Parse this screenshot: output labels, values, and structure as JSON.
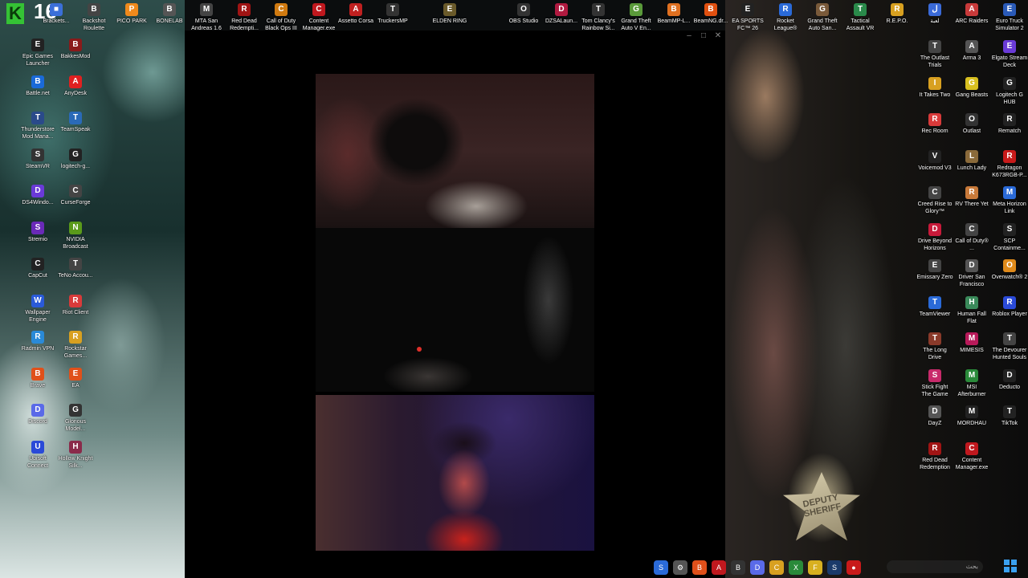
{
  "overlay": {
    "logo_letter": "K",
    "count": "16"
  },
  "window": {
    "controls": [
      "–",
      "□",
      "✕"
    ]
  },
  "badge": {
    "text": "DEPUTY SHERIFF"
  },
  "top_icons": [
    {
      "label": "Brackets...",
      "color": "#3b6fd8",
      "glyph": "■"
    },
    {
      "label": "Backshot Roulette",
      "color": "#444",
      "glyph": "B"
    },
    {
      "label": "PICO PARK",
      "color": "#f08a1c",
      "glyph": "P"
    },
    {
      "label": "BONELAB",
      "color": "#555",
      "glyph": "B"
    },
    {
      "label": "MTA San Andreas 1.6",
      "color": "#444",
      "glyph": "M"
    },
    {
      "label": "Red Dead Redempti...",
      "color": "#a01414",
      "glyph": "R"
    },
    {
      "label": "Call of Duty Black Ops III",
      "color": "#d07a10",
      "glyph": "C"
    },
    {
      "label": "Content Manager.exe",
      "color": "#c0181e",
      "glyph": "C"
    },
    {
      "label": "Assetto Corsa",
      "color": "#c02020",
      "glyph": "A"
    },
    {
      "label": "TruckersMP",
      "color": "#333",
      "glyph": "T"
    },
    {
      "label": "ELDEN RING",
      "color": "#6a5a2a",
      "glyph": "E"
    },
    {
      "label": "OBS Studio",
      "color": "#333",
      "glyph": "O"
    },
    {
      "label": "DZSALaun...",
      "color": "#b01a40",
      "glyph": "D"
    },
    {
      "label": "Tom Clancy's Rainbow Si...",
      "color": "#333",
      "glyph": "T"
    },
    {
      "label": "Grand Theft Auto V En...",
      "color": "#5a9a3a",
      "glyph": "G"
    },
    {
      "label": "BeamMP-L...",
      "color": "#e07020",
      "glyph": "B"
    },
    {
      "label": "BeamNG.dr...",
      "color": "#e05010",
      "glyph": "B"
    },
    {
      "label": "EA SPORTS FC™ 26",
      "color": "#222",
      "glyph": "E"
    },
    {
      "label": "Rocket League®",
      "color": "#2a6ad8",
      "glyph": "R"
    },
    {
      "label": "Grand Theft Auto San...",
      "color": "#7a5a3a",
      "glyph": "G"
    },
    {
      "label": "Tactical Assault VR",
      "color": "#2a8a4a",
      "glyph": "T"
    },
    {
      "label": "R.E.P.O.",
      "color": "#d8a020",
      "glyph": "R"
    },
    {
      "label": "لعبة",
      "color": "#3a6ad8",
      "glyph": "ل"
    },
    {
      "label": "ARC Raiders",
      "color": "#c83a3a",
      "glyph": "A"
    },
    {
      "label": "Euro Truck Simulator 2",
      "color": "#2a5ab8",
      "glyph": "E"
    }
  ],
  "left_icons": [
    {
      "label": "Epic Games Launcher",
      "color": "#222",
      "glyph": "E"
    },
    {
      "label": "BakkesMod",
      "color": "#8a1a1a",
      "glyph": "B"
    },
    {
      "label": "Battle.net",
      "color": "#1a6ad8",
      "glyph": "B"
    },
    {
      "label": "AnyDesk",
      "color": "#e02020",
      "glyph": "A"
    },
    {
      "label": "Thunderstore Mod Mana...",
      "color": "#2a4a8a",
      "glyph": "T"
    },
    {
      "label": "TeamSpeak",
      "color": "#2a6ab8",
      "glyph": "T"
    },
    {
      "label": "SteamVR",
      "color": "#333",
      "glyph": "S"
    },
    {
      "label": "logitech-g...",
      "color": "#222",
      "glyph": "G"
    },
    {
      "label": "DS4Windo...",
      "color": "#6a3ad8",
      "glyph": "D"
    },
    {
      "label": "CurseForge",
      "color": "#444",
      "glyph": "C"
    },
    {
      "label": "Stremio",
      "color": "#6a2ab8",
      "glyph": "S"
    },
    {
      "label": "NVIDIA Broadcast",
      "color": "#5a9a1a",
      "glyph": "N"
    },
    {
      "label": "CapCut",
      "color": "#222",
      "glyph": "C"
    },
    {
      "label": "TeNo Accou...",
      "color": "#444",
      "glyph": "T"
    },
    {
      "label": "Wallpaper Engine",
      "color": "#2a5ad8",
      "glyph": "W"
    },
    {
      "label": "Riot Client",
      "color": "#d83a3a",
      "glyph": "R"
    },
    {
      "label": "Radmin VPN",
      "color": "#2a8ad8",
      "glyph": "R"
    },
    {
      "label": "Rockstar Games...",
      "color": "#d8a020",
      "glyph": "R"
    },
    {
      "label": "Brave",
      "color": "#e0501a",
      "glyph": "B"
    },
    {
      "label": "EA",
      "color": "#e0501a",
      "glyph": "E"
    },
    {
      "label": "Discord",
      "color": "#5a6ae8",
      "glyph": "D"
    },
    {
      "label": "Glorious Model...",
      "color": "#333",
      "glyph": "G"
    },
    {
      "label": "Ubisoft Connect",
      "color": "#2a4ad8",
      "glyph": "U"
    },
    {
      "label": "Hollow Knight Silk...",
      "color": "#8a2a4a",
      "glyph": "H"
    }
  ],
  "right_icons": [
    {
      "label": "The Outlast Trials",
      "color": "#444",
      "glyph": "T"
    },
    {
      "label": "Arma 3",
      "color": "#555",
      "glyph": "A"
    },
    {
      "label": "Elgato Stream Deck",
      "color": "#6a3ad8",
      "glyph": "E"
    },
    {
      "label": "It Takes Two",
      "color": "#d8a020",
      "glyph": "I"
    },
    {
      "label": "Gang Beasts",
      "color": "#d8c020",
      "glyph": "G"
    },
    {
      "label": "Logitech G HUB",
      "color": "#222",
      "glyph": "G"
    },
    {
      "label": "Rec Room",
      "color": "#d83a3a",
      "glyph": "R"
    },
    {
      "label": "Outlast",
      "color": "#333",
      "glyph": "O"
    },
    {
      "label": "Rematch",
      "color": "#222",
      "glyph": "R"
    },
    {
      "label": "Voicemod V3",
      "color": "#222",
      "glyph": "V"
    },
    {
      "label": "Lunch Lady",
      "color": "#8a6a3a",
      "glyph": "L"
    },
    {
      "label": "Redragon K673RGB-P...",
      "color": "#c81a1a",
      "glyph": "R"
    },
    {
      "label": "Creed Rise to Glory™",
      "color": "#444",
      "glyph": "C"
    },
    {
      "label": "RV There Yet",
      "color": "#c87a3a",
      "glyph": "R"
    },
    {
      "label": "Meta Horizon Link",
      "color": "#2a6ad8",
      "glyph": "M"
    },
    {
      "label": "Drive Beyond Horizons",
      "color": "#c81a3a",
      "glyph": "D"
    },
    {
      "label": "Call of Duty® ...",
      "color": "#444",
      "glyph": "C"
    },
    {
      "label": "SCP Containme...",
      "color": "#222",
      "glyph": "S"
    },
    {
      "label": "Emissary Zero",
      "color": "#444",
      "glyph": "E"
    },
    {
      "label": "Driver San Francisco",
      "color": "#555",
      "glyph": "D"
    },
    {
      "label": "Overwatch® 2",
      "color": "#e08a1a",
      "glyph": "O"
    },
    {
      "label": "TeamViewer",
      "color": "#2a6ad8",
      "glyph": "T"
    },
    {
      "label": "Human Fall Flat",
      "color": "#3a8a5a",
      "glyph": "H"
    },
    {
      "label": "Roblox Player",
      "color": "#2a4ad8",
      "glyph": "R"
    },
    {
      "label": "The Long Drive",
      "color": "#8a3a2a",
      "glyph": "T"
    },
    {
      "label": "MIMESIS",
      "color": "#b81a5a",
      "glyph": "M"
    },
    {
      "label": "The Devourer Hunted Souls",
      "color": "#444",
      "glyph": "T"
    },
    {
      "label": "Stick Fight The Game",
      "color": "#c82a6a",
      "glyph": "S"
    },
    {
      "label": "MSI Afterburner",
      "color": "#2a8a3a",
      "glyph": "M"
    },
    {
      "label": "Deducto",
      "color": "#222",
      "glyph": "D"
    },
    {
      "label": "DayZ",
      "color": "#555",
      "glyph": "D"
    },
    {
      "label": "MORDHAU",
      "color": "#222",
      "glyph": "M"
    },
    {
      "label": "TikTok",
      "color": "#222",
      "glyph": "T"
    },
    {
      "label": "Red Dead Redemption",
      "color": "#a01414",
      "glyph": "R"
    },
    {
      "label": "Content Manager.exe",
      "color": "#c0181e",
      "glyph": "C"
    }
  ],
  "taskbar": {
    "items": [
      {
        "name": "steam",
        "color": "#2a6ad8",
        "glyph": "S"
      },
      {
        "name": "settings",
        "color": "#555",
        "glyph": "⚙"
      },
      {
        "name": "brave",
        "color": "#e0501a",
        "glyph": "B"
      },
      {
        "name": "app",
        "color": "#c0181e",
        "glyph": "A"
      },
      {
        "name": "app2",
        "color": "#333",
        "glyph": "B"
      },
      {
        "name": "discord",
        "color": "#5a6ae8",
        "glyph": "D"
      },
      {
        "name": "chrome",
        "color": "#d8a020",
        "glyph": "C"
      },
      {
        "name": "xbox",
        "color": "#2a8a3a",
        "glyph": "X"
      },
      {
        "name": "files",
        "color": "#d8b020",
        "glyph": "F"
      },
      {
        "name": "steam2",
        "color": "#1a3a6a",
        "glyph": "S"
      },
      {
        "name": "recorder",
        "color": "#c81a1a",
        "glyph": "●"
      }
    ],
    "search_placeholder": "بحث"
  }
}
